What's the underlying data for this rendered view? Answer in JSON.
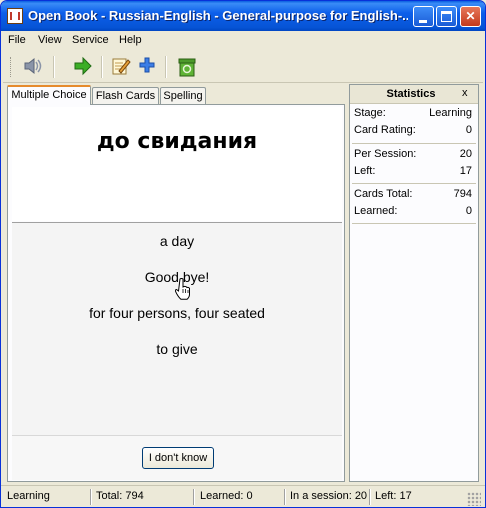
{
  "window": {
    "title": "Open Book - Russian-English - General-purpose for English-..."
  },
  "menu": [
    "File",
    "View",
    "Service",
    "Help"
  ],
  "toolbar": {
    "icons": [
      "speaker-icon",
      "arrow-right-icon",
      "edit-note-icon",
      "plus-icon",
      "trash-icon"
    ]
  },
  "tabs": [
    {
      "label": "Multiple Choice",
      "active": true
    },
    {
      "label": "Flash Cards",
      "active": false
    },
    {
      "label": "Spelling",
      "active": false
    }
  ],
  "card": {
    "word": "до свидания",
    "choices": [
      "a day",
      "Good bye!",
      "for four persons, four seated",
      "to give"
    ],
    "dont_know_label": "I don't know"
  },
  "statistics": {
    "title": "Statistics",
    "close": "x",
    "stage_label": "Stage:",
    "stage_value": "Learning",
    "rating_label": "Card Rating:",
    "rating_value": "0",
    "per_session_label": "Per Session:",
    "per_session_value": "20",
    "left_label": "Left:",
    "left_value": "17",
    "total_label": "Cards Total:",
    "total_value": "794",
    "learned_label": "Learned:",
    "learned_value": "0"
  },
  "status": {
    "mode": "Learning",
    "total": "Total: 794",
    "learned": "Learned: 0",
    "session": "In a session: 20",
    "left": "Left: 17"
  },
  "colors": {
    "title_bar": "#0654d6",
    "tab_highlight": "#e68b2c",
    "window_bg": "#ece9d8"
  }
}
